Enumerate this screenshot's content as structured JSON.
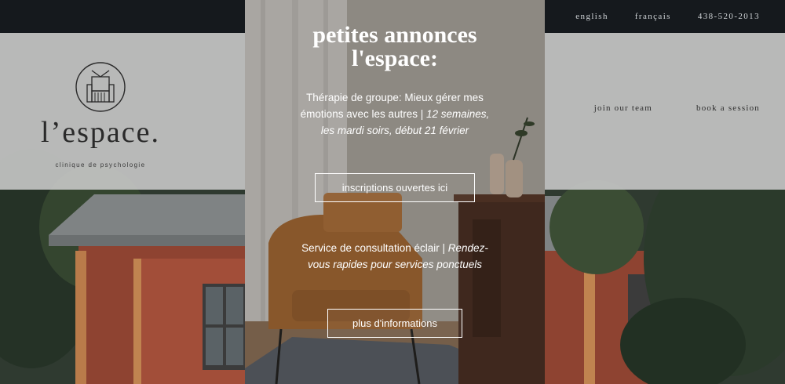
{
  "topbar": {
    "links": [
      "english",
      "français",
      "438-520-2013"
    ]
  },
  "logo": {
    "wordmark": "l’espace.",
    "tagline": "clinique de psychologie"
  },
  "nav": {
    "items": [
      "join our team",
      "book a session"
    ]
  },
  "announcements": {
    "title_line1": "petites annonces",
    "title_line2": "l'espace:",
    "item1_text": "Thérapie de groupe: Mieux gérer mes émotions avec les autres | ",
    "item1_italic": "12 semaines, les mardi soirs, début 21 février",
    "item1_button": "inscriptions ouvertes ici",
    "item2_text": "Service de consultation éclair | ",
    "item2_italic": "Rendez-vous rapides pour services ponctuels",
    "item2_button": "plus d'informations"
  },
  "colors": {
    "topbar": "#15191d",
    "header_overlay": "#c8c8c8",
    "brick": "#9a4a35",
    "chair": "#b56f32"
  }
}
